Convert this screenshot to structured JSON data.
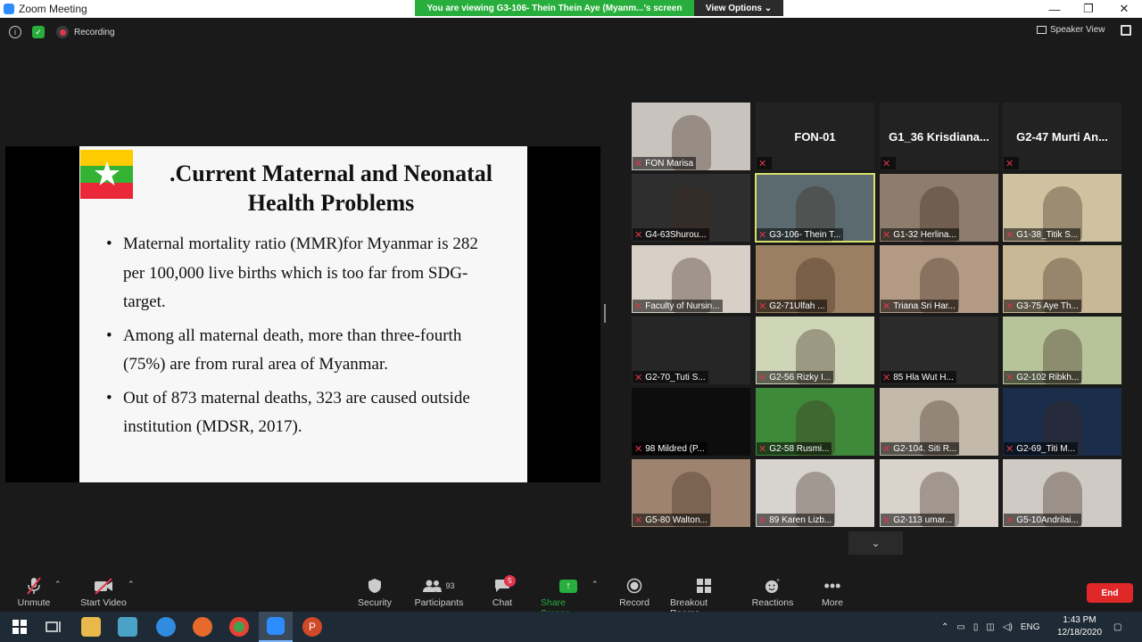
{
  "window": {
    "title": "Zoom Meeting",
    "minimize": "—",
    "maximize": "❐",
    "close": "✕"
  },
  "share_banner": {
    "message": "You are viewing G3-106- Thein Thein Aye (Myanm...'s screen",
    "view_options": "View Options ⌄"
  },
  "top_bar": {
    "recording_label": "Recording",
    "speaker_view_label": "Speaker View"
  },
  "slide": {
    "title_line1": ".Current Maternal and Neonatal",
    "title_line2": "Health Problems",
    "bullets": [
      "Maternal mortality ratio (MMR)for Myanmar is 282 per 100,000 live births which is too far from SDG-target.",
      "Among all maternal death, more than three-fourth (75%) are from rural area of Myanmar.",
      "Out of 873 maternal deaths, 323 are caused outside institution (MDSR, 2017)."
    ]
  },
  "gallery": [
    {
      "name": "FON Marisa",
      "big": ""
    },
    {
      "name": "",
      "big": "FON-01"
    },
    {
      "name": "",
      "big": "G1_36  Krisdiana..."
    },
    {
      "name": "",
      "big": "G2-47 Murti An..."
    },
    {
      "name": "G4-63Shurou...",
      "big": ""
    },
    {
      "name": "G3-106- Thein T...",
      "big": ""
    },
    {
      "name": "G1-32 Herlina...",
      "big": ""
    },
    {
      "name": "G1-38_Titik S...",
      "big": ""
    },
    {
      "name": "Faculty of Nursin...",
      "big": ""
    },
    {
      "name": "G2-71Ulfah ...",
      "big": ""
    },
    {
      "name": "Triana Sri Har...",
      "big": ""
    },
    {
      "name": "G3-75 Aye Th...",
      "big": ""
    },
    {
      "name": "G2-70_Tuti S...",
      "big": ""
    },
    {
      "name": "G2-56 Rizky I...",
      "big": ""
    },
    {
      "name": "85 Hla Wut H...",
      "big": ""
    },
    {
      "name": "G2-102 Ribkh...",
      "big": ""
    },
    {
      "name": "98 Mildred (P...",
      "big": ""
    },
    {
      "name": "G2-58 Rusmi...",
      "big": ""
    },
    {
      "name": "G2-104. Siti R...",
      "big": ""
    },
    {
      "name": "G2-69_Titi M...",
      "big": ""
    },
    {
      "name": "G5-80 Walton...",
      "big": ""
    },
    {
      "name": "89 Karen Lizb...",
      "big": ""
    },
    {
      "name": "G2-113 umar...",
      "big": ""
    },
    {
      "name": "G5-10Andrilai...",
      "big": ""
    }
  ],
  "tile_colors": [
    "#c9c3bd",
    "#222222",
    "#222222",
    "#222222",
    "#2e2e2e",
    "#5a6a6f",
    "#8c7d6e",
    "#cfc2a0",
    "#d8d0c6",
    "#9b7f62",
    "#b39a84",
    "#c8b896",
    "#262626",
    "#cfd6b8",
    "#2b2b2b",
    "#b7c49a",
    "#0d0d0d",
    "#3f8a3a",
    "#c2b9ab",
    "#1a2d4a",
    "#9e8470",
    "#d7d4d0",
    "#d9d3cc",
    "#cfcac3"
  ],
  "toolbar": {
    "unmute": "Unmute",
    "start_video": "Start Video",
    "security": "Security",
    "participants": "Participants",
    "participants_count": "93",
    "chat": "Chat",
    "chat_badge": "5",
    "share_screen": "Share Screen",
    "record": "Record",
    "breakout_rooms": "Breakout Rooms",
    "reactions": "Reactions",
    "more": "More",
    "end": "End"
  },
  "taskbar": {
    "lang": "ENG",
    "time": "1:43 PM",
    "date": "12/18/2020"
  },
  "colors": {
    "zoom_blue": "#2d8cff",
    "share_green": "#27ae3c",
    "end_red": "#e02828",
    "muted_red": "#e0354b",
    "active_border": "#d8e06a"
  }
}
